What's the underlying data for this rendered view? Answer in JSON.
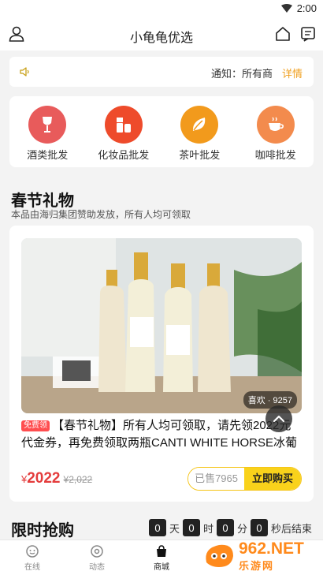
{
  "status_bar": {
    "time": "2:00"
  },
  "header": {
    "title": "小龟龟优选"
  },
  "notice": {
    "text": "通知：所有商",
    "detail_label": "详情"
  },
  "categories": [
    {
      "label": "酒类批发",
      "icon": "wine-glass-icon",
      "color": "#e85b5b"
    },
    {
      "label": "化妆品批发",
      "icon": "cosmetics-icon",
      "color": "#ee4b2b"
    },
    {
      "label": "茶叶批发",
      "icon": "tea-leaf-icon",
      "color": "#f29a1c"
    },
    {
      "label": "咖啡批发",
      "icon": "coffee-cup-icon",
      "color": "#f38b4d"
    }
  ],
  "section": {
    "title": "春节礼物",
    "subtitle": "本品由海归集团赞助发放，所有人均可领取"
  },
  "product": {
    "likes": "喜欢 · 9257",
    "tag": "免费领",
    "title": "【春节礼物】所有人均可领取，请先领2022元代金券，再免费领取两瓶CANTI WHITE HORSE冰葡萄…",
    "currency": "¥",
    "price": "2022",
    "original_price": "¥2,022",
    "sold": "已售7965",
    "buy_label": "立即购买"
  },
  "flash_sale": {
    "title": "限时抢购",
    "days": "0",
    "days_unit": "天",
    "hours": "0",
    "hours_unit": "时",
    "minutes": "0",
    "minutes_unit": "分",
    "seconds": "0",
    "seconds_suffix": "秒后结束"
  },
  "tabs": [
    {
      "label": "在线",
      "icon": "chat-icon"
    },
    {
      "label": "动态",
      "icon": "compass-icon"
    },
    {
      "label": "商城",
      "icon": "shopping-bag-icon"
    }
  ],
  "watermark": {
    "big": "962.NET",
    "small": "乐游网"
  },
  "colors": {
    "accent": "#f9d21b",
    "price_red": "#e43c3c",
    "notice_detail": "#f0a020"
  }
}
